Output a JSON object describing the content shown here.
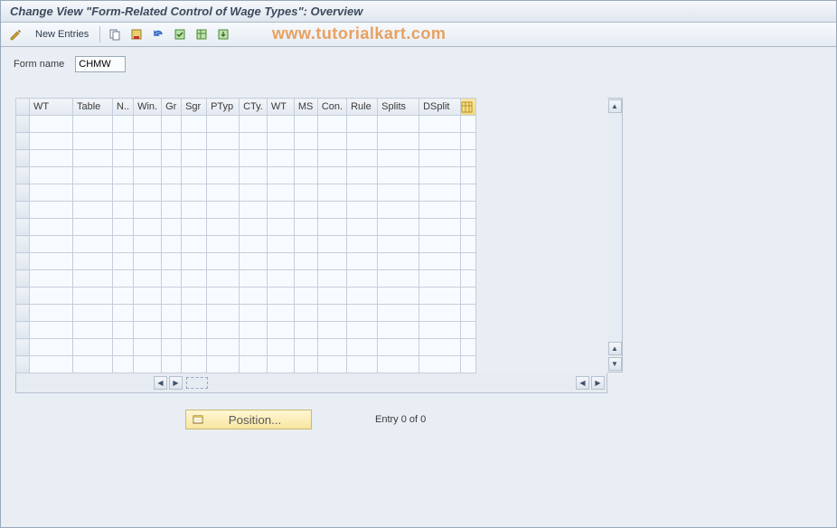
{
  "title": "Change View \"Form-Related Control of Wage Types\": Overview",
  "toolbar": {
    "new_entries_label": "New Entries"
  },
  "watermark": "www.tutorialkart.com",
  "form": {
    "name_label": "Form name",
    "name_value": "CHMW"
  },
  "table": {
    "columns": [
      "WT",
      "Table",
      "N..",
      "Win.",
      "Gr",
      "Sgr",
      "PTyp",
      "CTy.",
      "WT",
      "MS",
      "Con.",
      "Rule",
      "Splits",
      "DSplit"
    ],
    "rows": [
      [
        "",
        "",
        "",
        "",
        "",
        "",
        "",
        "",
        "",
        "",
        "",
        "",
        "",
        ""
      ],
      [
        "",
        "",
        "",
        "",
        "",
        "",
        "",
        "",
        "",
        "",
        "",
        "",
        "",
        ""
      ],
      [
        "",
        "",
        "",
        "",
        "",
        "",
        "",
        "",
        "",
        "",
        "",
        "",
        "",
        ""
      ],
      [
        "",
        "",
        "",
        "",
        "",
        "",
        "",
        "",
        "",
        "",
        "",
        "",
        "",
        ""
      ],
      [
        "",
        "",
        "",
        "",
        "",
        "",
        "",
        "",
        "",
        "",
        "",
        "",
        "",
        ""
      ],
      [
        "",
        "",
        "",
        "",
        "",
        "",
        "",
        "",
        "",
        "",
        "",
        "",
        "",
        ""
      ],
      [
        "",
        "",
        "",
        "",
        "",
        "",
        "",
        "",
        "",
        "",
        "",
        "",
        "",
        ""
      ],
      [
        "",
        "",
        "",
        "",
        "",
        "",
        "",
        "",
        "",
        "",
        "",
        "",
        "",
        ""
      ],
      [
        "",
        "",
        "",
        "",
        "",
        "",
        "",
        "",
        "",
        "",
        "",
        "",
        "",
        ""
      ],
      [
        "",
        "",
        "",
        "",
        "",
        "",
        "",
        "",
        "",
        "",
        "",
        "",
        "",
        ""
      ],
      [
        "",
        "",
        "",
        "",
        "",
        "",
        "",
        "",
        "",
        "",
        "",
        "",
        "",
        ""
      ],
      [
        "",
        "",
        "",
        "",
        "",
        "",
        "",
        "",
        "",
        "",
        "",
        "",
        "",
        ""
      ],
      [
        "",
        "",
        "",
        "",
        "",
        "",
        "",
        "",
        "",
        "",
        "",
        "",
        "",
        ""
      ],
      [
        "",
        "",
        "",
        "",
        "",
        "",
        "",
        "",
        "",
        "",
        "",
        "",
        "",
        ""
      ],
      [
        "",
        "",
        "",
        "",
        "",
        "",
        "",
        "",
        "",
        "",
        "",
        "",
        "",
        ""
      ]
    ]
  },
  "footer": {
    "position_label": "Position...",
    "entry_status": "Entry 0 of 0"
  },
  "icons": {
    "pencil": "pencil-icon",
    "copy": "copy-icon",
    "save": "save-icon",
    "undo": "undo-icon",
    "select_all": "select-all-icon",
    "table_settings": "table-settings-icon",
    "export": "export-icon",
    "position": "position-icon",
    "configure": "configure-column-icon"
  }
}
